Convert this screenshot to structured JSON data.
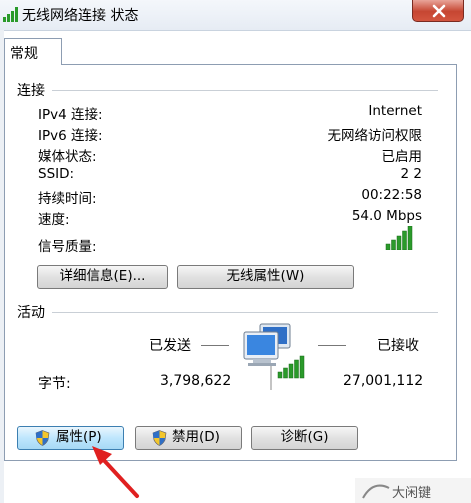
{
  "window": {
    "title": "无线网络连接 状态"
  },
  "tabs": [
    {
      "label": "常规"
    }
  ],
  "connection": {
    "section_label": "连接",
    "rows": [
      {
        "label": "IPv4 连接:",
        "value": "Internet"
      },
      {
        "label": "IPv6 连接:",
        "value": "无网络访问权限"
      },
      {
        "label": "媒体状态:",
        "value": "已启用"
      },
      {
        "label": "SSID:",
        "value": "2 2"
      },
      {
        "label": "持续时间:",
        "value": "00:22:58"
      },
      {
        "label": "速度:",
        "value": "54.0 Mbps"
      }
    ],
    "signal_label": "信号质量:",
    "signal_bars_filled": 5,
    "signal_bars_total": 5,
    "details_button": "详细信息(E)...",
    "wireless_props_button": "无线属性(W)"
  },
  "activity": {
    "section_label": "活动",
    "sent_label": "已发送",
    "received_label": "已接收",
    "bytes_label": "字节:",
    "bytes_sent": "3,798,622",
    "bytes_received": "27,001,112"
  },
  "bottom_buttons": {
    "properties": "属性(P)",
    "disable": "禁用(D)",
    "diagnose": "诊断(G)"
  },
  "watermark": {
    "text": "大闲键"
  },
  "colors": {
    "signal_green": "#2a9a2a",
    "annotation_arrow": "#e02020"
  }
}
